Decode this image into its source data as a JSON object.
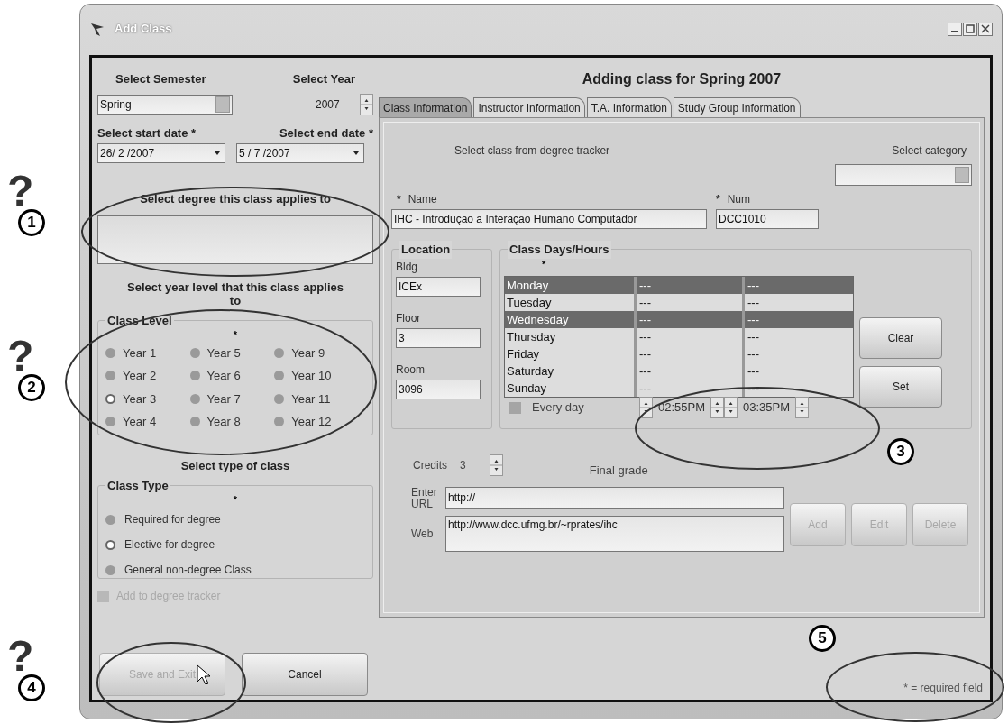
{
  "window": {
    "title": "Add Class"
  },
  "semester": {
    "label": "Select Semester",
    "value": "Spring"
  },
  "year": {
    "label": "Select Year",
    "value": "2007"
  },
  "start_date": {
    "label": "Select start date *",
    "value": "26/ 2 /2007"
  },
  "end_date": {
    "label": "Select end date *",
    "value": "5 / 7 /2007"
  },
  "degree": {
    "label": "Select degree this class applies to"
  },
  "year_level": {
    "prompt": "Select year level that this class applies to",
    "group": "Class Level",
    "required_mark": "*",
    "options": [
      {
        "label": "Year 1",
        "selected": false
      },
      {
        "label": "Year 2",
        "selected": false
      },
      {
        "label": "Year 3",
        "selected": true
      },
      {
        "label": "Year 4",
        "selected": false
      },
      {
        "label": "Year 5",
        "selected": false
      },
      {
        "label": "Year 6",
        "selected": false
      },
      {
        "label": "Year 7",
        "selected": false
      },
      {
        "label": "Year 8",
        "selected": false
      },
      {
        "label": "Year 9",
        "selected": false
      },
      {
        "label": "Year 10",
        "selected": false
      },
      {
        "label": "Year 11",
        "selected": false
      },
      {
        "label": "Year 12",
        "selected": false
      }
    ]
  },
  "class_type": {
    "prompt": "Select type of class",
    "group": "Class Type",
    "required_mark": "*",
    "options": [
      {
        "label": "Required for degree",
        "selected": false
      },
      {
        "label": "Elective for degree",
        "selected": true
      },
      {
        "label": "General non-degree Class",
        "selected": false
      }
    ]
  },
  "degree_tracker": {
    "label": "Add to degree tracker",
    "checked": false,
    "disabled": true
  },
  "heading": "Adding class for Spring 2007",
  "tabs": [
    {
      "label": "Class Information",
      "selected": true
    },
    {
      "label": "Instructor Information",
      "selected": false
    },
    {
      "label": "T.A. Information",
      "selected": false
    },
    {
      "label": "Study Group Information",
      "selected": false
    }
  ],
  "tracker_label": "Select class from degree tracker",
  "category_label": "Select category",
  "name": {
    "required_mark": "*",
    "label": "Name",
    "value": "IHC - Introdução a Interação Humano Computador"
  },
  "num": {
    "required_mark": "*",
    "label": "Num",
    "value": "DCC1010"
  },
  "location": {
    "group": "Location",
    "fields": [
      {
        "label": "Bldg",
        "value": "ICEx"
      },
      {
        "label": "Floor",
        "value": "3"
      },
      {
        "label": "Room",
        "value": "3096"
      }
    ]
  },
  "days": {
    "group": "Class Days/Hours",
    "required_mark": "*",
    "rows": [
      {
        "day": "Monday",
        "start": "---",
        "end": "---",
        "selected": true
      },
      {
        "day": "Tuesday",
        "start": "---",
        "end": "---",
        "selected": false
      },
      {
        "day": "Wednesday",
        "start": "---",
        "end": "---",
        "selected": true
      },
      {
        "day": "Thursday",
        "start": "---",
        "end": "---",
        "selected": false
      },
      {
        "day": "Friday",
        "start": "---",
        "end": "---",
        "selected": false
      },
      {
        "day": "Saturday",
        "start": "---",
        "end": "---",
        "selected": false
      },
      {
        "day": "Sunday",
        "start": "---",
        "end": "---",
        "selected": false
      }
    ],
    "every_day": {
      "label": "Every day",
      "checked": false
    },
    "start_time": "02:55PM",
    "end_time": "03:35PM"
  },
  "day_buttons": [
    {
      "label": "Clear",
      "disabled": false
    },
    {
      "label": "Set",
      "disabled": false
    }
  ],
  "credits": {
    "label": "Credits",
    "value": "3"
  },
  "final_grade": "Final grade",
  "url": {
    "label": "Enter URL",
    "value": "http://"
  },
  "web": {
    "label": "Web",
    "value": "http://www.dcc.ufmg.br/~rprates/ihc"
  },
  "url_buttons": [
    {
      "label": "Add",
      "disabled": true
    },
    {
      "label": "Edit",
      "disabled": true
    },
    {
      "label": "Delete",
      "disabled": true
    }
  ],
  "footer_buttons": [
    {
      "label": "Save and Exit",
      "disabled": true
    },
    {
      "label": "Cancel",
      "disabled": false
    }
  ],
  "required_note": "* = required field",
  "annotations": [
    {
      "mark": "?",
      "number": "1"
    },
    {
      "mark": "?",
      "number": "2"
    },
    {
      "number": "3"
    },
    {
      "mark": "?",
      "number": "4"
    },
    {
      "number": "5"
    }
  ]
}
